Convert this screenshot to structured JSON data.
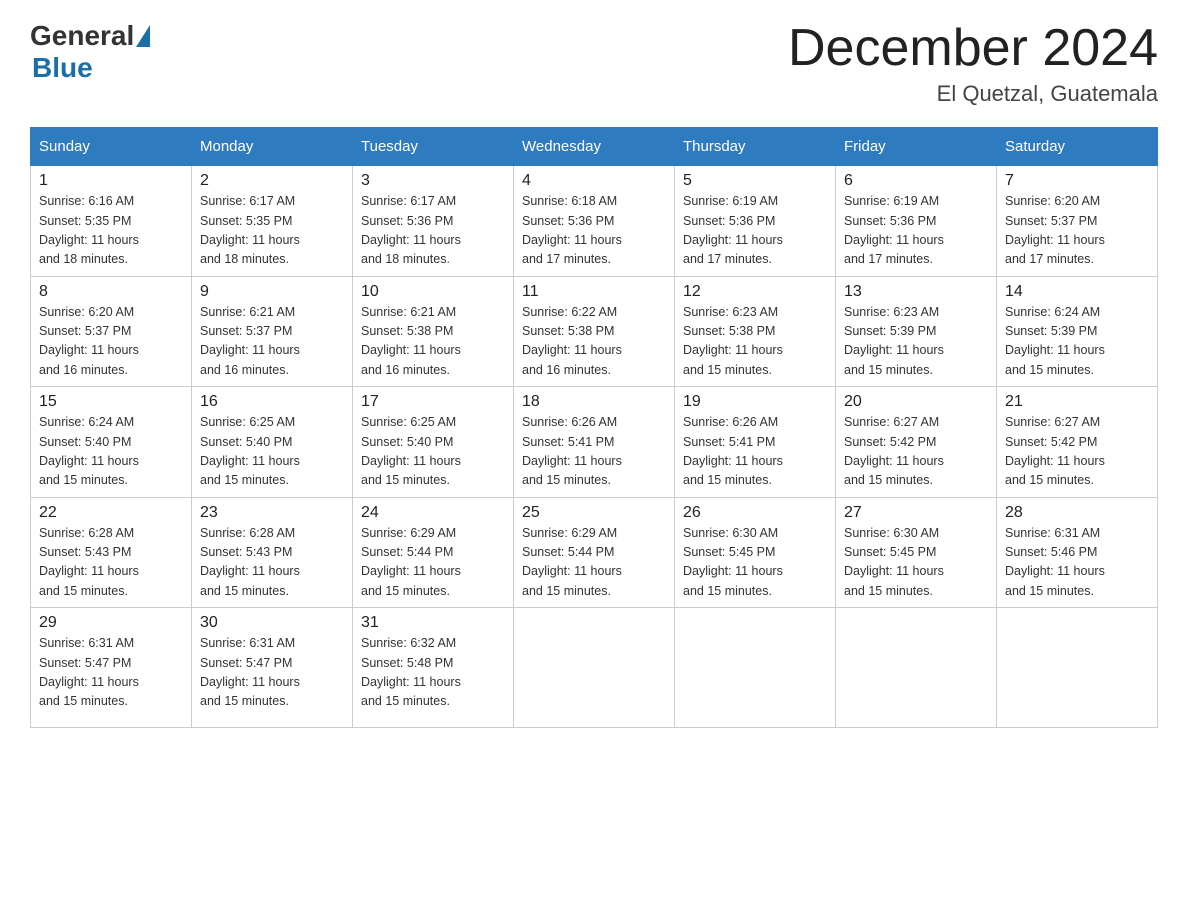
{
  "header": {
    "logo_general": "General",
    "logo_blue": "Blue",
    "title": "December 2024",
    "location": "El Quetzal, Guatemala"
  },
  "days_of_week": [
    "Sunday",
    "Monday",
    "Tuesday",
    "Wednesday",
    "Thursday",
    "Friday",
    "Saturday"
  ],
  "weeks": [
    [
      {
        "day": "1",
        "sunrise": "6:16 AM",
        "sunset": "5:35 PM",
        "daylight": "11 hours and 18 minutes."
      },
      {
        "day": "2",
        "sunrise": "6:17 AM",
        "sunset": "5:35 PM",
        "daylight": "11 hours and 18 minutes."
      },
      {
        "day": "3",
        "sunrise": "6:17 AM",
        "sunset": "5:36 PM",
        "daylight": "11 hours and 18 minutes."
      },
      {
        "day": "4",
        "sunrise": "6:18 AM",
        "sunset": "5:36 PM",
        "daylight": "11 hours and 17 minutes."
      },
      {
        "day": "5",
        "sunrise": "6:19 AM",
        "sunset": "5:36 PM",
        "daylight": "11 hours and 17 minutes."
      },
      {
        "day": "6",
        "sunrise": "6:19 AM",
        "sunset": "5:36 PM",
        "daylight": "11 hours and 17 minutes."
      },
      {
        "day": "7",
        "sunrise": "6:20 AM",
        "sunset": "5:37 PM",
        "daylight": "11 hours and 17 minutes."
      }
    ],
    [
      {
        "day": "8",
        "sunrise": "6:20 AM",
        "sunset": "5:37 PM",
        "daylight": "11 hours and 16 minutes."
      },
      {
        "day": "9",
        "sunrise": "6:21 AM",
        "sunset": "5:37 PM",
        "daylight": "11 hours and 16 minutes."
      },
      {
        "day": "10",
        "sunrise": "6:21 AM",
        "sunset": "5:38 PM",
        "daylight": "11 hours and 16 minutes."
      },
      {
        "day": "11",
        "sunrise": "6:22 AM",
        "sunset": "5:38 PM",
        "daylight": "11 hours and 16 minutes."
      },
      {
        "day": "12",
        "sunrise": "6:23 AM",
        "sunset": "5:38 PM",
        "daylight": "11 hours and 15 minutes."
      },
      {
        "day": "13",
        "sunrise": "6:23 AM",
        "sunset": "5:39 PM",
        "daylight": "11 hours and 15 minutes."
      },
      {
        "day": "14",
        "sunrise": "6:24 AM",
        "sunset": "5:39 PM",
        "daylight": "11 hours and 15 minutes."
      }
    ],
    [
      {
        "day": "15",
        "sunrise": "6:24 AM",
        "sunset": "5:40 PM",
        "daylight": "11 hours and 15 minutes."
      },
      {
        "day": "16",
        "sunrise": "6:25 AM",
        "sunset": "5:40 PM",
        "daylight": "11 hours and 15 minutes."
      },
      {
        "day": "17",
        "sunrise": "6:25 AM",
        "sunset": "5:40 PM",
        "daylight": "11 hours and 15 minutes."
      },
      {
        "day": "18",
        "sunrise": "6:26 AM",
        "sunset": "5:41 PM",
        "daylight": "11 hours and 15 minutes."
      },
      {
        "day": "19",
        "sunrise": "6:26 AM",
        "sunset": "5:41 PM",
        "daylight": "11 hours and 15 minutes."
      },
      {
        "day": "20",
        "sunrise": "6:27 AM",
        "sunset": "5:42 PM",
        "daylight": "11 hours and 15 minutes."
      },
      {
        "day": "21",
        "sunrise": "6:27 AM",
        "sunset": "5:42 PM",
        "daylight": "11 hours and 15 minutes."
      }
    ],
    [
      {
        "day": "22",
        "sunrise": "6:28 AM",
        "sunset": "5:43 PM",
        "daylight": "11 hours and 15 minutes."
      },
      {
        "day": "23",
        "sunrise": "6:28 AM",
        "sunset": "5:43 PM",
        "daylight": "11 hours and 15 minutes."
      },
      {
        "day": "24",
        "sunrise": "6:29 AM",
        "sunset": "5:44 PM",
        "daylight": "11 hours and 15 minutes."
      },
      {
        "day": "25",
        "sunrise": "6:29 AM",
        "sunset": "5:44 PM",
        "daylight": "11 hours and 15 minutes."
      },
      {
        "day": "26",
        "sunrise": "6:30 AM",
        "sunset": "5:45 PM",
        "daylight": "11 hours and 15 minutes."
      },
      {
        "day": "27",
        "sunrise": "6:30 AM",
        "sunset": "5:45 PM",
        "daylight": "11 hours and 15 minutes."
      },
      {
        "day": "28",
        "sunrise": "6:31 AM",
        "sunset": "5:46 PM",
        "daylight": "11 hours and 15 minutes."
      }
    ],
    [
      {
        "day": "29",
        "sunrise": "6:31 AM",
        "sunset": "5:47 PM",
        "daylight": "11 hours and 15 minutes."
      },
      {
        "day": "30",
        "sunrise": "6:31 AM",
        "sunset": "5:47 PM",
        "daylight": "11 hours and 15 minutes."
      },
      {
        "day": "31",
        "sunrise": "6:32 AM",
        "sunset": "5:48 PM",
        "daylight": "11 hours and 15 minutes."
      },
      null,
      null,
      null,
      null
    ]
  ],
  "labels": {
    "sunrise": "Sunrise:",
    "sunset": "Sunset:",
    "daylight": "Daylight:"
  }
}
